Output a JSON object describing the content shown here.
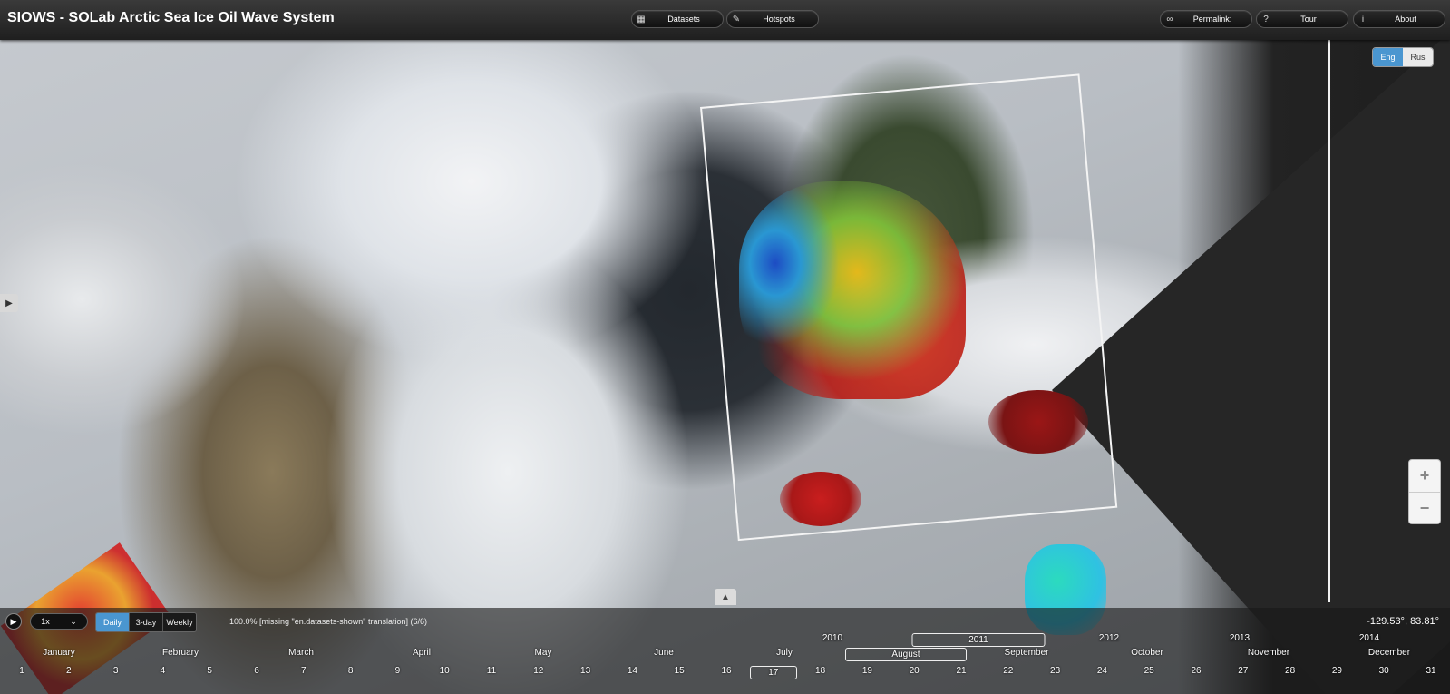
{
  "header": {
    "title": "SIOWS - SOLab Arctic Sea Ice Oil Wave System",
    "datasets_label": "Datasets",
    "hotspots_label": "Hotspots",
    "permalink_label": "Permalink:",
    "tour_label": "Tour",
    "about_label": "About"
  },
  "language": {
    "eng": "Eng",
    "rus": "Rus",
    "active": "Eng"
  },
  "map": {
    "zoom_in": "+",
    "zoom_out": "−",
    "expand_panel": "▶",
    "collapse_timeline": "▲"
  },
  "timeline": {
    "play": "▶",
    "speed": "1x",
    "speed_arrow": "⌄",
    "intervals": [
      "Daily",
      "3-day",
      "Weekly"
    ],
    "active_interval": "Daily",
    "status": "100.0% [missing \"en.datasets-shown\" translation] (6/6)",
    "coordinates": "-129.53°, 83.81°",
    "years": [
      "2010",
      "2011",
      "2012",
      "2013",
      "2014"
    ],
    "selected_year": "2011",
    "months": [
      "January",
      "February",
      "March",
      "April",
      "May",
      "June",
      "July",
      "August",
      "September",
      "October",
      "November",
      "December"
    ],
    "selected_month": "August",
    "days": [
      "1",
      "2",
      "3",
      "4",
      "5",
      "6",
      "7",
      "8",
      "9",
      "10",
      "11",
      "12",
      "13",
      "14",
      "15",
      "16",
      "17",
      "18",
      "19",
      "20",
      "21",
      "22",
      "23",
      "24",
      "25",
      "26",
      "27",
      "28",
      "29",
      "30",
      "31"
    ],
    "selected_day": "17"
  },
  "colors": {
    "accent": "#4a96d0",
    "topbar": "#2a2a2a",
    "frame": "#f4f4f4"
  },
  "icons": {
    "datasets": "grid-icon",
    "hotspots": "wrench-icon",
    "permalink": "link-icon",
    "tour": "question-icon",
    "about": "info-icon"
  }
}
